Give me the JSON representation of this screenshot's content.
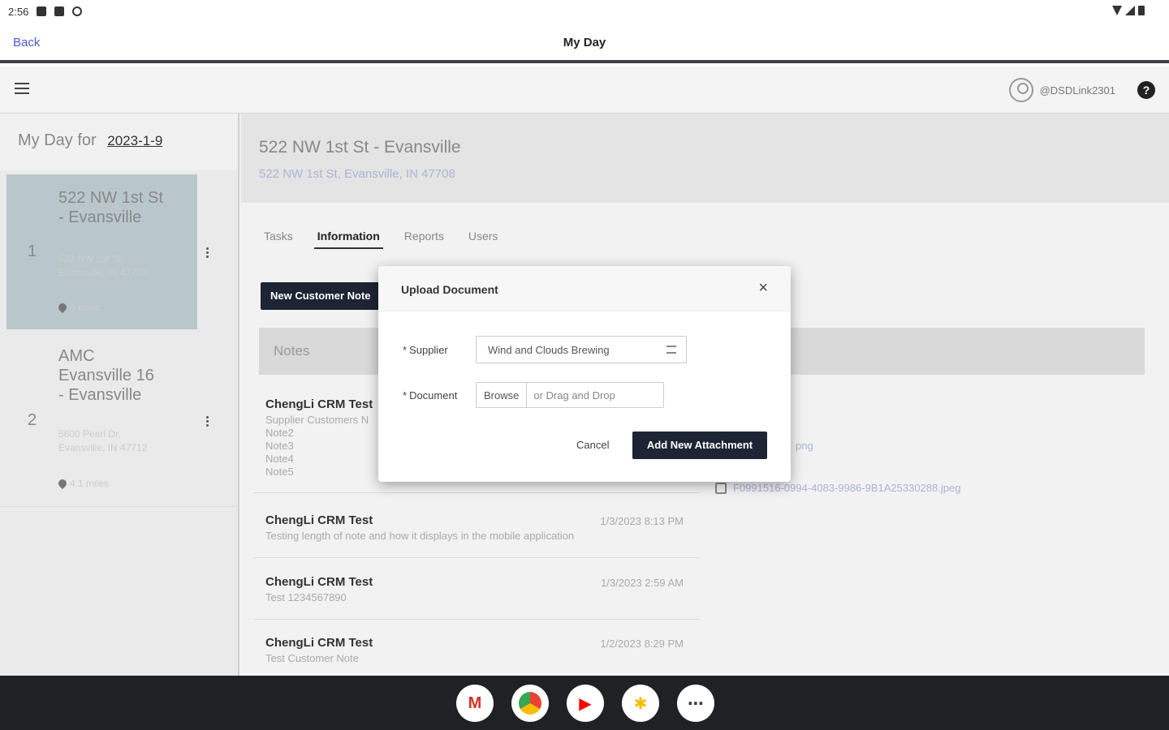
{
  "status_bar": {
    "time": "2:56"
  },
  "app_bar": {
    "back_label": "Back",
    "title": "My Day"
  },
  "top_nav": {
    "username": "@DSDLink2301",
    "help_label": "?"
  },
  "sidebar": {
    "heading": "My Day for",
    "date": "2023-1-9",
    "stops": [
      {
        "number": "1",
        "name": "522 NW 1st St - Evansville",
        "address": "522 NW 1st St Evansville, IN 47708",
        "distance": "0 miles"
      },
      {
        "number": "2",
        "name": "AMC Evansville 16 - Evansville",
        "address": "5600 Pearl Dr, Evansville, IN 47712",
        "distance": "4.1 miles"
      }
    ]
  },
  "main": {
    "title": "522 NW 1st St - Evansville",
    "address": "522 NW 1st St, Evansville, IN 47708",
    "tabs": [
      {
        "label": "Tasks"
      },
      {
        "label": "Information"
      },
      {
        "label": "Reports"
      },
      {
        "label": "Users"
      }
    ],
    "new_note_label": "New Customer Note",
    "notes_label": "Notes",
    "notes": [
      {
        "author": "ChengLi CRM Test",
        "timestamp": "",
        "body": [
          "Supplier Customers N",
          "Note2",
          "Note3",
          "Note4",
          "Note5"
        ]
      },
      {
        "author": "ChengLi CRM Test",
        "timestamp": "1/3/2023 8:13 PM",
        "body": [
          "Testing length of note and how it displays in the mobile application"
        ]
      },
      {
        "author": "ChengLi CRM Test",
        "timestamp": "1/3/2023 2:59 AM",
        "body": [
          "Test 1234567890"
        ]
      },
      {
        "author": "ChengLi CRM Test",
        "timestamp": "1/2/2023 8:29 PM",
        "body": [
          "Test Customer Note"
        ]
      }
    ],
    "attachment_ext": "png",
    "attachment_file": "F0991516-0994-4083-9986-9B1A25330288.jpeg"
  },
  "modal": {
    "title": "Upload Document",
    "close_label": "×",
    "supplier_label": "Supplier",
    "supplier_value": "Wind and Clouds Brewing",
    "document_label": "Document",
    "browse_label": "Browse",
    "drop_label": "or Drag and Drop",
    "cancel_label": "Cancel",
    "add_label": "Add New Attachment"
  },
  "dock": {
    "apps": [
      {
        "icon": "gmail-icon",
        "glyph": "M",
        "color": "#d93025"
      },
      {
        "icon": "chrome-icon",
        "glyph": "",
        "color": "#1a73e8"
      },
      {
        "icon": "youtube-icon",
        "glyph": "▶",
        "color": "#ff0000"
      },
      {
        "icon": "photos-icon",
        "glyph": "✱",
        "color": "#fbbc04"
      },
      {
        "icon": "app-launcher-icon",
        "glyph": "⋯",
        "color": "#3c4043"
      }
    ]
  }
}
